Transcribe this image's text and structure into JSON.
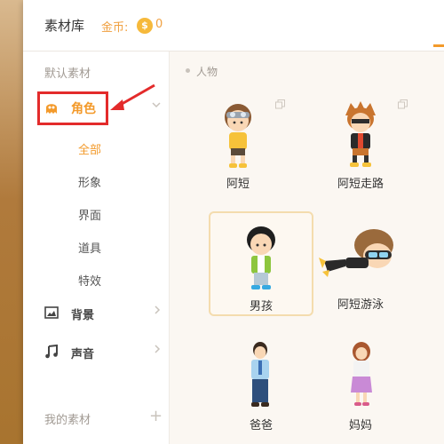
{
  "header": {
    "title": "素材库",
    "coin_label": "金币:",
    "coin_symbol": "$",
    "coin_value": "0"
  },
  "sidebar": {
    "default_materials": "默认素材",
    "role": {
      "label": "角色"
    },
    "sub_items": [
      "全部",
      "形象",
      "界面",
      "道具",
      "特效"
    ],
    "background": {
      "label": "背景"
    },
    "sound": {
      "label": "声音"
    },
    "my_materials": "我的素材",
    "add_symbol": "+"
  },
  "content": {
    "section": "人物",
    "items": [
      {
        "name": "阿短"
      },
      {
        "name": "阿短走路"
      },
      {
        "name": "男孩"
      },
      {
        "name": "阿短游泳"
      },
      {
        "name": "爸爸"
      },
      {
        "name": "妈妈"
      }
    ]
  },
  "colors": {
    "accent": "#f39a2b",
    "highlight_box": "#e32b2b"
  }
}
